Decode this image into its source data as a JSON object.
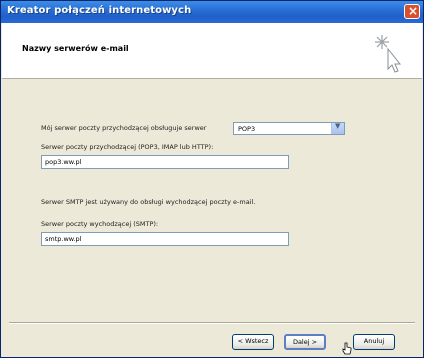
{
  "window": {
    "title": "Kreator połączeń internetowych",
    "close_symbol": "×"
  },
  "header": {
    "title": "Nazwy serwerów e-mail",
    "icon": "wizard-sparkle-cursor-icon"
  },
  "form": {
    "incoming_type_label": "Mój serwer poczty przychodzącej obsługuje serwer",
    "incoming_type_value": "POP3",
    "incoming_server_label": "Serwer poczty przychodzącej (POP3, IMAP lub HTTP):",
    "incoming_server_value": "pop3.ww.pl",
    "smtp_note": "Serwer SMTP jest używany do obsługi wychodzącej poczty e-mail.",
    "outgoing_server_label": "Serwer poczty wychodzącej (SMTP):",
    "outgoing_server_value": "smtp.ww.pl"
  },
  "buttons": {
    "back": "< Wstecz",
    "next": "Dalej >",
    "cancel": "Anuluj"
  },
  "colors": {
    "titlebar": "#2a6fd6",
    "close": "#d8512e",
    "dialog_bg": "#ece9d8"
  }
}
